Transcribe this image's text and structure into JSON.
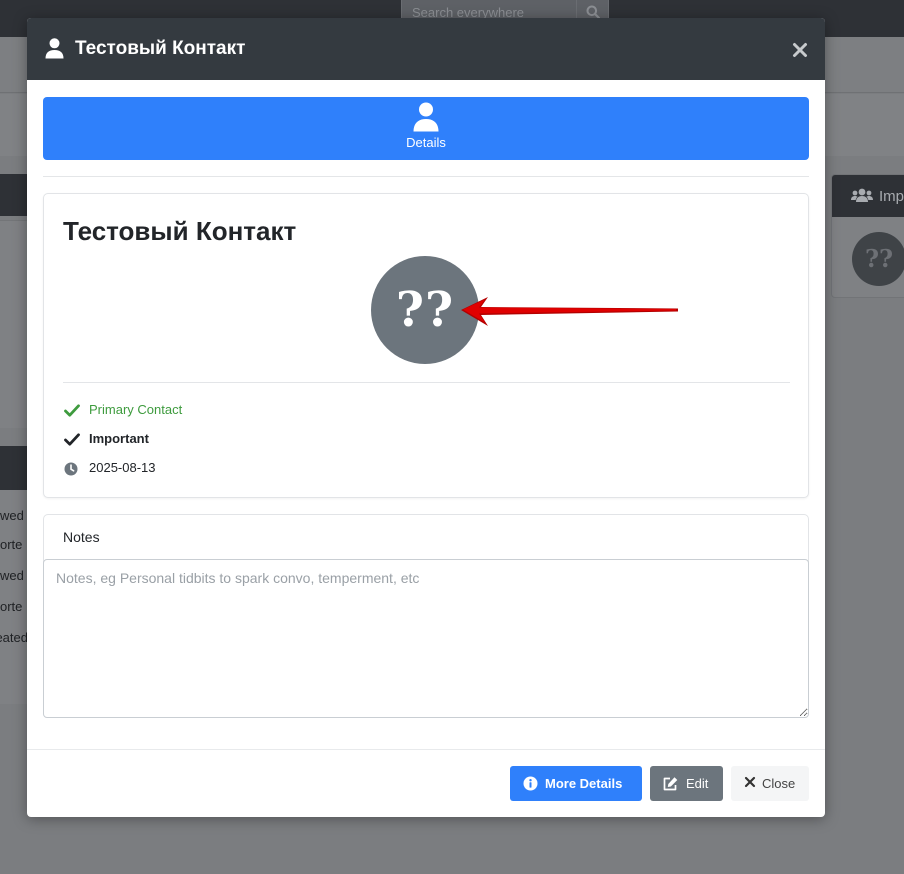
{
  "background": {
    "search_placeholder": "Search everywhere",
    "right_card_header": "Imp",
    "right_card_avatar": "??",
    "left_list_items": [
      "wed",
      "orte",
      "wed",
      "orte",
      "eated"
    ]
  },
  "modal": {
    "title": "Тестовый Контакт",
    "tab": {
      "label": "Details",
      "icon": "user-icon"
    },
    "contact": {
      "name": "Тестовый Контакт",
      "avatar_text": "??",
      "primary_contact_label": "Primary Contact",
      "important_label": "Important",
      "date": "2025-08-13"
    },
    "notes": {
      "label": "Notes",
      "value": "",
      "placeholder": "Notes, eg Personal tidbits to spark convo, temperment, etc"
    },
    "footer": {
      "more_details_label": "More Details",
      "edit_label": "Edit",
      "close_label": "Close"
    }
  },
  "colors": {
    "primary": "#2f80fb",
    "header_dark": "#343a40",
    "secondary": "#6c757d",
    "success": "#3e9b3e",
    "annotation_arrow": "#e00000"
  }
}
